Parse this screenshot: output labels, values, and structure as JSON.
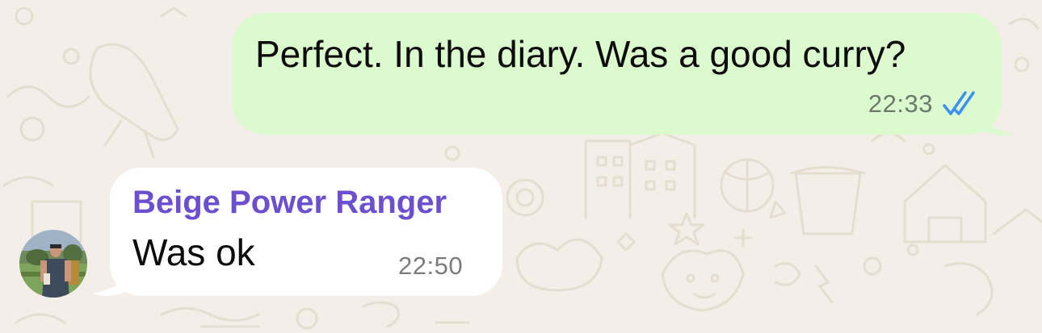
{
  "messages": {
    "outgoing": {
      "text": "Perfect. In the diary. Was a good curry?",
      "time": "22:33",
      "status_icon": "double-check-read-icon"
    },
    "incoming": {
      "sender": "Beige Power Ranger",
      "text": "Was ok",
      "time": "22:50"
    }
  },
  "colors": {
    "background": "#f3eee8",
    "outgoing_bubble": "#dbfacd",
    "incoming_bubble": "#ffffff",
    "sender_name": "#6b4fce",
    "read_ticks": "#3b8ff0"
  }
}
